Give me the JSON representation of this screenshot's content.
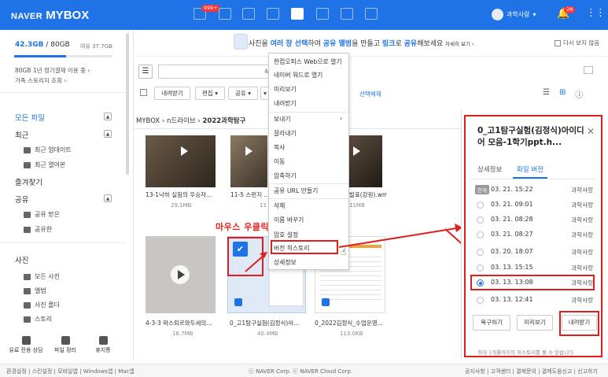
{
  "topbar": {
    "logo_naver": "NAVER",
    "logo_mybox": "MYBOX",
    "badge_count": "999+",
    "user_name": "과학사랑",
    "notif_count": "28"
  },
  "sidebar": {
    "storage_used": "42.3GB",
    "storage_total": "/ 80GB",
    "storage_remaining": "여유 37.7GB",
    "storage_fraction": 0.53,
    "plan_text": "80GB 1년 정기결제 이용 중 ›",
    "family_text": "가족 스토리지 조회 ›",
    "sections": {
      "all_files": "모든 파일",
      "recent": "최근",
      "recent_update": "최근 업데이트",
      "recent_open": "최근 열어본",
      "favorites": "즐겨찾기",
      "shared": "공유",
      "shared_received": "공유 받은",
      "shared_sent": "공유한",
      "photos": "사진",
      "all_photos": "모든 사진",
      "album": "앨범",
      "photo_folder": "사진 폴더",
      "story": "스토리"
    },
    "bottom": {
      "consult": "유료 전용 상담",
      "organize": "파일 정리",
      "trash": "휴지통"
    }
  },
  "banner": {
    "part1": "사진을 ",
    "part2": "여러 장 선택",
    "part3": "하여 ",
    "part4": "공유 앨범",
    "part5": "을 만들고 ",
    "part6": "링크",
    "part7": "로 ",
    "part8": "공유",
    "part9": "해보세요",
    "more": "자세히 보기 ›",
    "dont_show": "다시 보지 않음"
  },
  "toolbar": {
    "search_fragment": "식",
    "download": "내려받기",
    "edit": "편집 ▾",
    "share": "공유 ▾",
    "more": "▾",
    "count": "1",
    "deselect": "선택해제"
  },
  "breadcrumb": {
    "root": "MYBOX",
    "sep": "›",
    "drive": "n드라이브",
    "sep2": "›",
    "folder": "2022과학탐구"
  },
  "files": [
    {
      "name": "13-1낙하 실험의 우승자...",
      "size": "29.1MB"
    },
    {
      "name": "11-5 스펀지 ...",
      "size": "11"
    },
    {
      "name": "발표(강원).wmv",
      "size": "11MB"
    },
    {
      "name": "4-3-3 파스퇴르와두세의...",
      "size": "16.7MB"
    },
    {
      "name": "0_고1탐구실험(김정식)아...",
      "size": "40.4MB"
    },
    {
      "name": "0_2022김정식_수업운영...",
      "size": "113.0KB"
    }
  ],
  "context_menu": [
    "한컴오피스 Web으로 열기",
    "네이버 워드로 열기",
    "미리보기",
    "내려받기",
    "보내기",
    "잘라내기",
    "복사",
    "이동",
    "압축하기",
    "공유 URL 만들기",
    "삭제",
    "이름 바꾸기",
    "암호 설정",
    "버전 히스토리",
    "상세정보"
  ],
  "annotation": "마우스 우클릭",
  "panel": {
    "title": "0_고1탐구실험(김정식)아이디어 모음-1학기ppt.h...",
    "tab_info": "상세정보",
    "tab_versions": "파일 버전",
    "current_label": "현재",
    "versions": [
      {
        "date": "03. 21. 15:22",
        "who": "과학사랑"
      },
      {
        "date": "03. 21. 09:01",
        "who": "과학사랑"
      },
      {
        "date": "03. 21. 08:28",
        "who": "과학사랑"
      },
      {
        "date": "03. 21. 08:27",
        "who": "과학사랑"
      },
      {
        "date": "03. 20. 18:07",
        "who": "과학사랑"
      },
      {
        "date": "03. 13. 15:15",
        "who": "과학사랑"
      },
      {
        "date": "03. 13. 13:08",
        "who": "과학사랑"
      },
      {
        "date": "03. 13. 12:41",
        "who": "과학사랑"
      }
    ],
    "restore": "복구하기",
    "preview": "미리보기",
    "download": "내려받기",
    "note": "최대 1개월까지의 히스토리를 볼 수 있습니다."
  },
  "footer": {
    "links": "환경설정 | 스킨설정 | 모바일앱 | Windows앱 | Mac앱",
    "copyright": "ⓒ NAVER Corp. ⓒ NAVER Cloud Corp.",
    "right": "공지사항 | 고객센터 | 결제문의 | 결제도움신고 | 신고하기"
  }
}
